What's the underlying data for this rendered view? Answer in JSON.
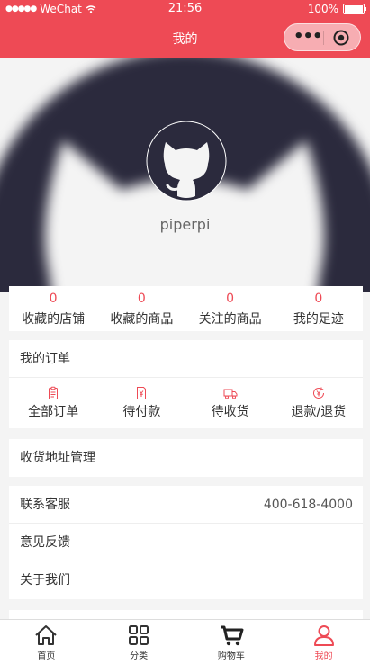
{
  "status_bar": {
    "carrier": "WeChat",
    "time": "21:56",
    "battery": "100%"
  },
  "nav": {
    "title": "我的"
  },
  "profile": {
    "username": "piperpi"
  },
  "stats": [
    {
      "count": "0",
      "label": "收藏的店铺"
    },
    {
      "count": "0",
      "label": "收藏的商品"
    },
    {
      "count": "0",
      "label": "关注的商品"
    },
    {
      "count": "0",
      "label": "我的足迹"
    }
  ],
  "orders": {
    "title": "我的订单",
    "items": [
      {
        "label": "全部订单",
        "icon": "clipboard-icon"
      },
      {
        "label": "待付款",
        "icon": "payment-document-icon"
      },
      {
        "label": "待收货",
        "icon": "delivery-truck-icon"
      },
      {
        "label": "退款/退货",
        "icon": "refund-yen-icon"
      }
    ]
  },
  "address": {
    "label": "收货地址管理"
  },
  "service": {
    "contact_label": "联系客服",
    "phone": "400-618-4000",
    "feedback_label": "意见反馈",
    "about_label": "关于我们"
  },
  "tabs": [
    {
      "label": "首页",
      "icon": "home-icon"
    },
    {
      "label": "分类",
      "icon": "category-grid-icon"
    },
    {
      "label": "购物车",
      "icon": "cart-icon"
    },
    {
      "label": "我的",
      "icon": "user-icon"
    }
  ],
  "colors": {
    "brand": "#ee4a55",
    "avatar_bg": "#2b2a3d"
  }
}
